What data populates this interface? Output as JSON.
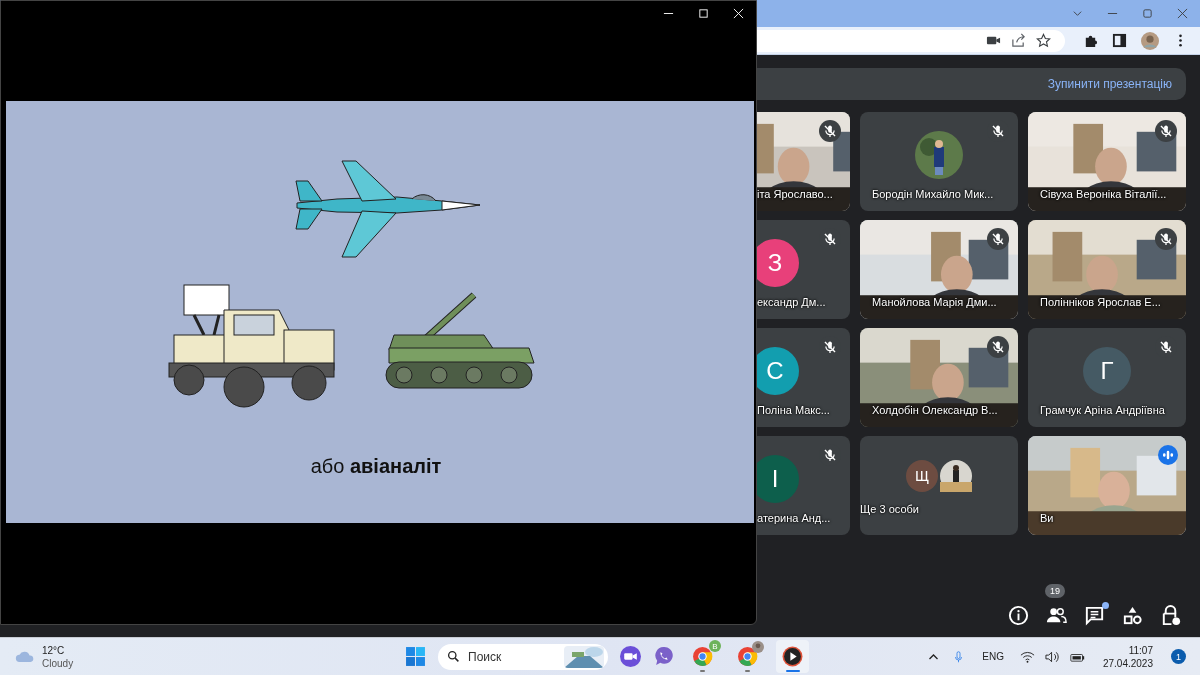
{
  "presentation_bar": {
    "stop_button": "Зупинити презентацію"
  },
  "participants": [
    {
      "kind": "video",
      "name": "іта Ярославо...",
      "muted": true,
      "speaking": false
    },
    {
      "name": "Бородін Михайло Мик...",
      "muted": true,
      "speaking": false
    },
    {
      "kind": "video",
      "name": "Сівуха Вероніка Віталії...",
      "muted": true,
      "speaking": false
    },
    {
      "kind": "avatar",
      "letter": "З",
      "color": "#e8407a",
      "name": "ександр Дм...",
      "muted": true,
      "speaking": false
    },
    {
      "kind": "video",
      "name": "Манойлова Марія Дми...",
      "muted": true,
      "speaking": false
    },
    {
      "kind": "video",
      "name": "Полінніков Ярослав Е...",
      "muted": true,
      "speaking": false
    },
    {
      "kind": "avatar",
      "letter": "С",
      "color": "#129eaf",
      "name": "Поліна Макс...",
      "muted": true,
      "speaking": false
    },
    {
      "kind": "video",
      "name": "Холдобін Олександр В...",
      "muted": true,
      "speaking": false
    },
    {
      "kind": "avatar",
      "letter": "Г",
      "color": "#455a64",
      "name": "Грамчук Аріна Андріївна",
      "muted": true,
      "speaking": false
    },
    {
      "kind": "avatar",
      "letter": "І",
      "color": "#0d5f4c",
      "name": "атерина Анд...",
      "muted": true,
      "speaking": false
    },
    {
      "kind": "overflow",
      "letter": "Щ",
      "color": "#6d4c41",
      "name": "Ще 3 особи",
      "muted": false,
      "speaking": false
    },
    {
      "kind": "video",
      "name": "Ви",
      "muted": false,
      "speaking": true
    }
  ],
  "toolbar": {
    "people_count": "19",
    "chat_unread": true
  },
  "popup_window": {
    "slide": {
      "caption": "або **авіаналіт**"
    }
  },
  "taskbar": {
    "temperature": "12°C",
    "weather": "Cloudy",
    "search_placeholder": "Поиск",
    "chrome_profile_letter": "В",
    "language": "ENG",
    "time": "11:07",
    "date": "27.04.2023",
    "notifications": "1"
  }
}
